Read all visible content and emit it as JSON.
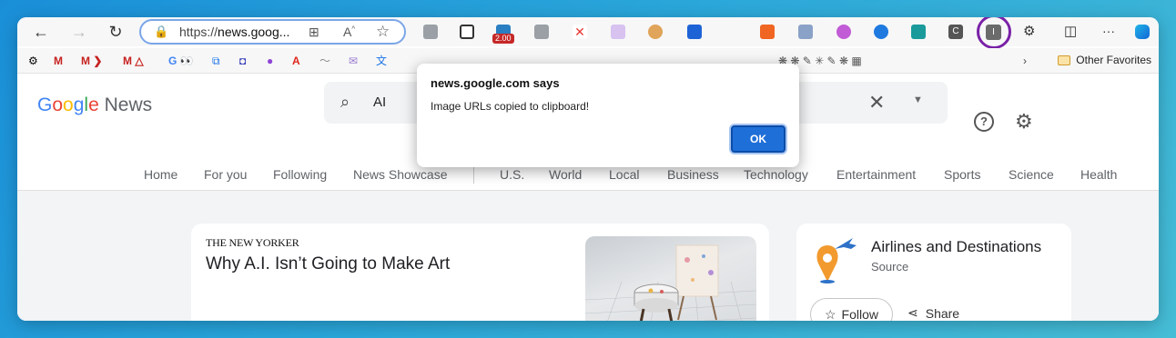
{
  "browser": {
    "url_scheme": "https://",
    "url_host": "news.goog...",
    "extension_badge": "2.00",
    "other_favorites_label": "Other Favorites",
    "accent_ring_color": "#7a21a8",
    "favorites": [
      {
        "icon": "gear-icon",
        "glyph": "⚙"
      },
      {
        "icon": "gmail-icon",
        "glyph": "M"
      },
      {
        "icon": "gmail-icon",
        "glyph": "M ❯"
      },
      {
        "icon": "gmail-icon",
        "glyph": "M △"
      },
      {
        "icon": "google-icon",
        "glyph": "G 👀"
      },
      {
        "icon": "calendar-icon",
        "glyph": "⧉"
      },
      {
        "icon": "app-icon",
        "glyph": "◘"
      },
      {
        "icon": "app-icon",
        "glyph": "●"
      },
      {
        "icon": "adobe-icon",
        "glyph": "A"
      },
      {
        "icon": "wave-icon",
        "glyph": "〜"
      },
      {
        "icon": "mail-icon",
        "glyph": "✉"
      },
      {
        "icon": "translate-icon",
        "glyph": "文"
      }
    ]
  },
  "page": {
    "logo_parts": [
      "G",
      "o",
      "o",
      "g",
      "l",
      "e"
    ],
    "logo_suffix": " News",
    "search_query": "AI",
    "tabs": [
      "Home",
      "For you",
      "Following",
      "News Showcase",
      "U.S.",
      "World",
      "Local",
      "Business",
      "Technology",
      "Entertainment",
      "Sports",
      "Science",
      "Health"
    ],
    "article": {
      "publisher": "THE NEW YORKER",
      "headline": "Why A.I. Isn’t Going to Make Art"
    },
    "source_card": {
      "title": "Airlines and Destinations",
      "subtitle": "Source",
      "follow_label": "Follow",
      "share_label": "Share"
    }
  },
  "dialog": {
    "title": "news.google.com says",
    "message": "Image URLs copied to clipboard!",
    "ok_label": "OK"
  }
}
